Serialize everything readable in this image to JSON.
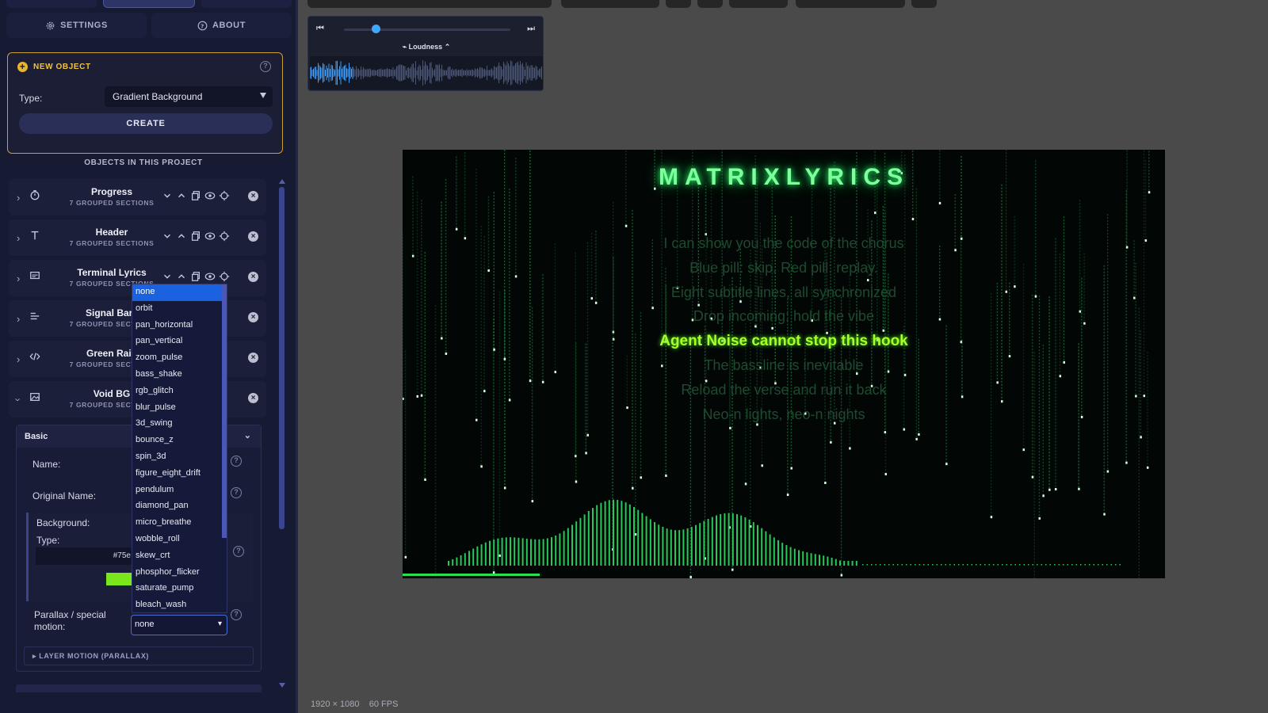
{
  "nav": {
    "settings_label": "SETTINGS",
    "about_label": "ABOUT"
  },
  "new_object": {
    "heading": "NEW OBJECT",
    "type_label": "Type:",
    "type_value": "Gradient Background",
    "create_label": "CREATE"
  },
  "objects_title": "OBJECTS IN THIS PROJECT",
  "objects": [
    {
      "name": "Progress",
      "sub": "7 GROUPED SECTIONS",
      "icon": "timer-icon"
    },
    {
      "name": "Header",
      "sub": "7 GROUPED SECTIONS",
      "icon": "text-icon"
    },
    {
      "name": "Terminal Lyrics",
      "sub": "7 GROUPED SECTIONS",
      "icon": "subtitles-icon"
    },
    {
      "name": "Signal Bars",
      "sub": "7 GROUPED SECTIONS",
      "icon": "align-lines-icon"
    },
    {
      "name": "Green Rain",
      "sub": "7 GROUPED SECTIONS",
      "icon": "code-icon"
    },
    {
      "name": "Void BG",
      "sub": "7 GROUPED SECTIONS",
      "icon": "image-icon"
    }
  ],
  "void_panel": {
    "section": "Basic",
    "name_label": "Name:",
    "original_name_label": "Original Name:",
    "background_label": "Background:",
    "bg_type_label": "Type:",
    "hex_value": "#75e",
    "swatch_color": "#7ae61c",
    "motion_label_1": "Parallax / special",
    "motion_label_2": "motion:",
    "motion_value": "none",
    "layer_motion_label": "LAYER MOTION (PARALLAX)"
  },
  "motion_options": [
    "none",
    "orbit",
    "pan_horizontal",
    "pan_vertical",
    "zoom_pulse",
    "bass_shake",
    "rgb_glitch",
    "blur_pulse",
    "3d_swing",
    "bounce_z",
    "spin_3d",
    "figure_eight_drift",
    "pendulum",
    "diamond_pan",
    "micro_breathe",
    "wobble_roll",
    "skew_crt",
    "phosphor_flicker",
    "saturate_pump",
    "bleach_wash"
  ],
  "audio": {
    "loudness_label": "Loudness",
    "progress": 0.19
  },
  "preview": {
    "title": "MATRIXLYRICS",
    "lyrics": [
      "I can show you the code of the chorus",
      "Blue pill: skip. Red pill: replay.",
      "Eight subtitle lines, all synchronized",
      "Drop incoming: hold the vibe",
      "Agent Noise cannot stop this hook",
      "The bassline is inevitable",
      "Reload the verse and run it back",
      "Neo-n lights, neo-n nights"
    ],
    "active_index": 4,
    "playback_progress": 0.18,
    "accent": "#28e050",
    "highlight": "#a8ff2a"
  },
  "status": {
    "resolution": "1920 × 1080",
    "fps": "60 FPS"
  }
}
